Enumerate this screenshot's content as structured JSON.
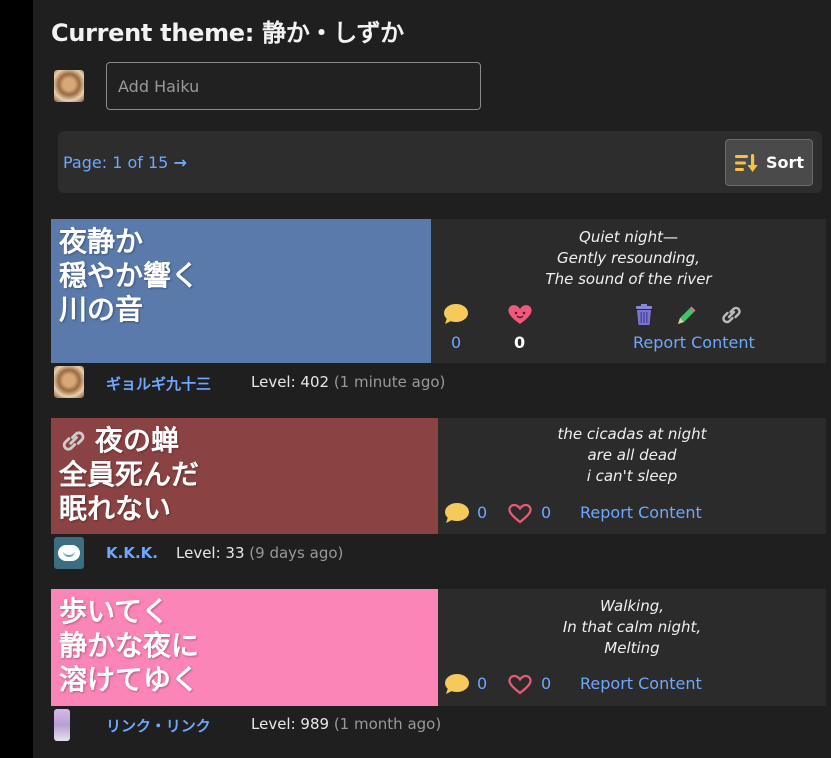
{
  "theme_title": "Current theme: 静か・しずか",
  "add_haiku": {
    "placeholder": "Add Haiku"
  },
  "pager": {
    "label": "Page: 1 of 15",
    "arrow": "→"
  },
  "sort": {
    "label": "Sort",
    "icon": "sort-down-icon"
  },
  "colors": {
    "card1": "#5a7aab",
    "card2": "#8b4242",
    "card3": "#fc85b7",
    "link": "#6ea8fe",
    "bg": "#1f1f1f"
  },
  "haikus": [
    {
      "jp": "夜静か\n穏やか響く\n川の音",
      "en": "Quiet night—\nGently resounding,\nThe sound of the river",
      "comments": "0",
      "likes": "0",
      "report": "Report Content",
      "user": "ギョルギ九十三",
      "level": "Level: 402",
      "ago": "(1 minute ago)"
    },
    {
      "jp_line1": "夜の蝉",
      "jp_rest": "全員死んだ\n眠れない",
      "en": "the cicadas at night\nare all dead\ni can't sleep",
      "comments": "0",
      "likes": "0",
      "report": "Report Content",
      "user": "K.K.K.",
      "level": "Level: 33",
      "ago": "(9 days ago)"
    },
    {
      "jp": "歩いてく\n静かな夜に\n溶けてゆく",
      "en": "Walking,\nIn that calm night,\nMelting",
      "comments": "0",
      "likes": "0",
      "report": "Report Content",
      "user": "リンク・リンク",
      "level": "Level: 989",
      "ago": "(1 month ago)"
    }
  ]
}
